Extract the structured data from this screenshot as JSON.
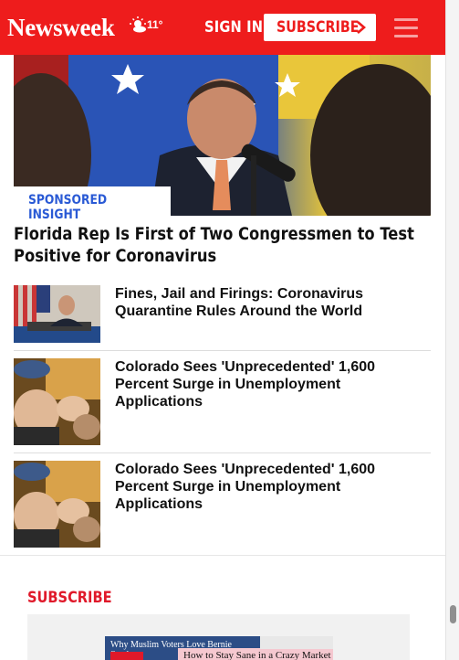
{
  "header": {
    "brand": "Newsweek",
    "weather_temp": "11°",
    "signin_label": "SIGN IN",
    "subscribe_label": "SUBSCRIBE",
    "colors": {
      "brand_red": "#ee1c1c",
      "white": "#ffffff"
    }
  },
  "hero": {
    "badge": "SPONSORED INSIGHT",
    "headline": "Florida Rep Is First of Two Congressmen to Test Positive for Coronavirus"
  },
  "stories": [
    {
      "title": "Fines, Jail and Firings: Coronavirus Quarantine Rules Around the World"
    },
    {
      "title": "Colorado Sees 'Unprecedented' 1,600 Percent Surge in Unemployment Applications"
    },
    {
      "title": "Colorado Sees 'Unprecedented' 1,600 Percent Surge in Unemployment Applications"
    }
  ],
  "subscribe_section": {
    "heading": "SUBSCRIBE",
    "cover_text_1": "Why Muslim Voters Love Bernie Sanders",
    "cover_text_2": "How to Stay Sane in a Crazy Market"
  },
  "icons": {
    "weather": "sun-cloud-icon",
    "chevron": "chevron-right-icon",
    "menu": "hamburger-menu-icon"
  }
}
